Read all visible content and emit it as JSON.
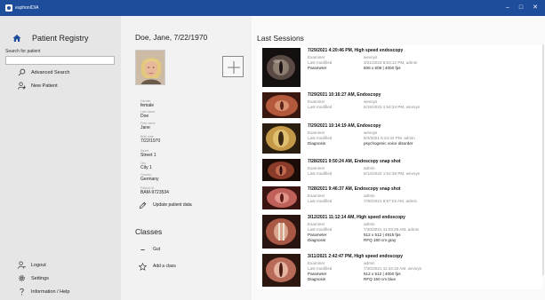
{
  "window": {
    "title": "euphonIDIA",
    "controls": {
      "minimize": "–",
      "maximize": "□",
      "close": "✕"
    }
  },
  "colors": {
    "titlebar": "#1e4d9b",
    "sidebar": "#e6e6e6",
    "patient_panel": "#f2f2f2",
    "sessions_panel": "#fafafa",
    "muted_text": "#8a8a8a"
  },
  "sidebar": {
    "title": "Patient Registry",
    "title_icon": "home-icon",
    "search": {
      "label": "Search for patient",
      "value": ""
    },
    "top_items": [
      {
        "label": "Advanced Search",
        "icon": "search-icon"
      },
      {
        "label": "New Patient",
        "icon": "add-person-icon"
      }
    ],
    "bottom_items": [
      {
        "label": "Logout",
        "icon": "logout-icon"
      },
      {
        "label": "Settings",
        "icon": "gear-icon"
      },
      {
        "label": "Information / Help",
        "icon": "help-icon"
      }
    ]
  },
  "patient": {
    "name": "Doe, Jane, 7/22/1970",
    "add_button_icon": "plus-icon",
    "fields": [
      {
        "label": "Gender",
        "value": "female"
      },
      {
        "label": "Last name",
        "value": "Doe"
      },
      {
        "label": "First name",
        "value": "Jane"
      },
      {
        "label": "Birth date",
        "value": "7/22/1970"
      },
      {
        "label": "Street",
        "value": "Street 1"
      },
      {
        "label": "City",
        "value": "City 1"
      },
      {
        "label": "Country",
        "value": "Germany"
      },
      {
        "label": "Patient ID",
        "value": "BAM-9723534"
      }
    ],
    "update_label": "Update patient data",
    "classes_title": "Classes",
    "classes": [
      {
        "label": "Gut",
        "icon": "minus-icon"
      },
      {
        "label": "Add a class",
        "icon": "star-icon"
      }
    ]
  },
  "sessions": {
    "title": "Last Sessions",
    "items": [
      {
        "heading": "7/29/2021 4:20:46 PM, High speed endoscopy",
        "thumb": "glottis-dark",
        "rows": [
          {
            "key": "Examiner",
            "value": "wevoys"
          },
          {
            "key": "Last modified",
            "value": "3/21/2023 8:53:12 PM, admin"
          },
          {
            "key": "Parameter",
            "value": "608 x 608 | 4000 fps"
          }
        ]
      },
      {
        "heading": "7/29/2021 10:16:27 AM, Endoscopy",
        "thumb": "larynx-red",
        "rows": [
          {
            "key": "Examiner",
            "value": "wevoys"
          },
          {
            "key": "Last modified",
            "value": "5/15/2022 1:54:34 PM, wevoys"
          }
        ]
      },
      {
        "heading": "7/29/2021 10:14:19 AM, Endoscopy",
        "thumb": "glottis-yellow",
        "rows": [
          {
            "key": "Examiner",
            "value": "wevoys"
          },
          {
            "key": "Last modified",
            "value": "8/3/2021 5:24:34 PM, admin"
          },
          {
            "key": "Diagnosis",
            "value": "psychogenic voice disorder"
          }
        ]
      },
      {
        "heading": "7/28/2021 9:50:24 AM, Endoscopy snap shot",
        "thumb": "larynx-dark",
        "rows": [
          {
            "key": "Examiner",
            "value": "admin"
          },
          {
            "key": "Last modified",
            "value": "5/13/2022 1:54:38 PM, wevoys"
          }
        ]
      },
      {
        "heading": "7/28/2021 9:46:37 AM, Endoscopy snap shot",
        "thumb": "larynx-pink",
        "rows": [
          {
            "key": "Examiner",
            "value": "admin"
          },
          {
            "key": "Last modified",
            "value": "7/30/2021 9:57:02 AM, admin"
          }
        ]
      },
      {
        "heading": "3/12/2021 11:12:14 AM, High speed endoscopy",
        "thumb": "glottis-red",
        "rows": [
          {
            "key": "Examiner",
            "value": "admin"
          },
          {
            "key": "Last modified",
            "value": "7/30/2021 11:03:28 AM, admin"
          },
          {
            "key": "Parameter",
            "value": "512 x 512 | 4915 fps"
          },
          {
            "key": "Diagnosis",
            "value": "RFQ 180 cm gray"
          }
        ]
      },
      {
        "heading": "3/11/2021 2:42:47 PM, High speed endoscopy",
        "thumb": "glottis-pink",
        "rows": [
          {
            "key": "Examiner",
            "value": "admin"
          },
          {
            "key": "Last modified",
            "value": "7/30/2021 11:44:33 AM, wevoys"
          },
          {
            "key": "Parameter",
            "value": "512 x 512 | 4000 fps"
          },
          {
            "key": "Diagnosis",
            "value": "RFQ 150 cm blue"
          }
        ]
      }
    ]
  }
}
